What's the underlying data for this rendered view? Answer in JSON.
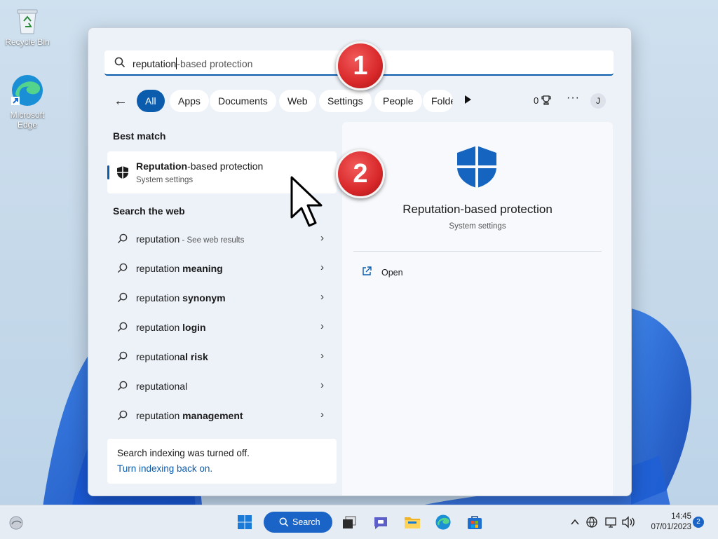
{
  "desktop": {
    "recycle_bin": "Recycle Bin",
    "edge_line1": "Microsoft",
    "edge_line2": "Edge"
  },
  "search": {
    "query_typed": "reputation",
    "query_completion": "-based protection"
  },
  "filters": {
    "back": "←",
    "items": [
      "All",
      "Apps",
      "Documents",
      "Web",
      "Settings",
      "People",
      "Folde"
    ],
    "points": "0",
    "more": "···",
    "avatar": "J"
  },
  "best_match": {
    "heading": "Best match",
    "name_bold": "Reputation",
    "name_rest": "-based protection",
    "subtitle": "System settings"
  },
  "web": {
    "heading": "Search the web",
    "results": [
      {
        "prefix": "reputation",
        "bold": "",
        "suffix": " - See web results"
      },
      {
        "prefix": "reputation ",
        "bold": "meaning",
        "suffix": ""
      },
      {
        "prefix": "reputation ",
        "bold": "synonym",
        "suffix": ""
      },
      {
        "prefix": "reputation ",
        "bold": "login",
        "suffix": ""
      },
      {
        "prefix": "reputation",
        "bold": "al risk",
        "suffix": ""
      },
      {
        "prefix": "reputation",
        "bold": "al",
        "suffix": ""
      },
      {
        "prefix": "reputation ",
        "bold": "management",
        "suffix": ""
      }
    ]
  },
  "indexing": {
    "message": "Search indexing was turned off.",
    "link": "Turn indexing back on."
  },
  "preview": {
    "title": "Reputation-based protection",
    "subtitle": "System settings",
    "open_label": "Open"
  },
  "callouts": [
    "1",
    "2"
  ],
  "taskbar": {
    "search_label": "Search",
    "time": "14:45",
    "date": "07/01/2023",
    "notification_count": "2"
  },
  "colors": {
    "accent": "#0b5cad",
    "badge_red": "#d8282a"
  }
}
